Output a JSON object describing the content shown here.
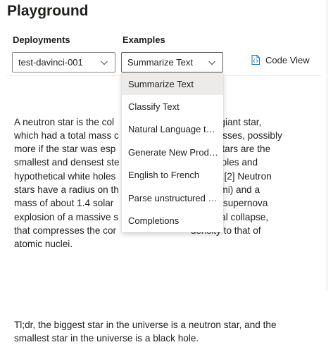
{
  "header": {
    "title": "Playground"
  },
  "deployments": {
    "label": "Deployments",
    "selected": "test-davinci-001"
  },
  "examples": {
    "label": "Examples",
    "selected": "Summarize Text",
    "options": [
      "Summarize Text",
      "Classify Text",
      "Natural Language to...",
      "Generate New Produ...",
      "English to French",
      "Parse unstructured d...",
      "Completions"
    ]
  },
  "toolbar": {
    "code_view_label": "Code View"
  },
  "prompt": {
    "paragraph1": "A neutron star is the col                          ve supergiant star,\nwhich had a total mass c                           olar masses, possibly\nmore if the star was esp                           eutron stars are the\nsmallest and densest ste                           black holes and\nhypothetical white holes                           ge stars.[2] Neutron\nstars have a radius on th                          es (6.2 mi) and a\nmass of about 1.4 solar                            rom the supernova\nexplosion of a massive s                           vitational collapse,\nthat compresses the cor                            density to that of\natomic nuclei.",
    "paragraph2": "Tl;dr, the biggest star in the universe is a neutron star, and the\nsmallest star in the universe is a black hole."
  },
  "colors": {
    "selected_bg": "#edebe9",
    "border": "#8a8886",
    "text": "#201f1e"
  },
  "icons": {
    "code_view": "code-file-icon",
    "dropdown": "chevron-down-icon"
  }
}
